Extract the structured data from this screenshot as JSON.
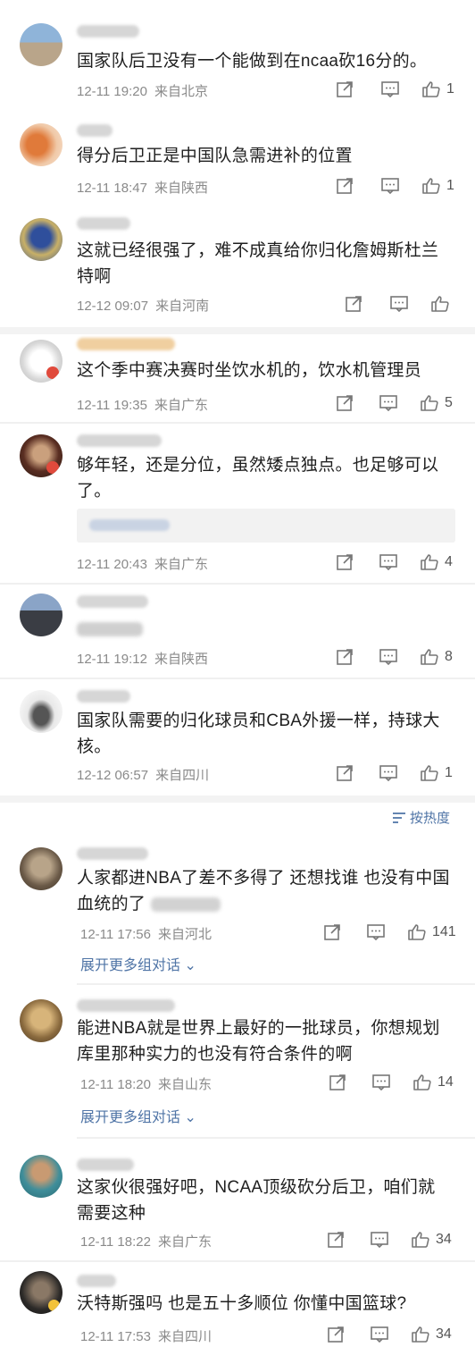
{
  "comments": [
    {
      "text": "国家队后卫没有一个能做到在ncaa砍16分的。",
      "time": "12-11 19:20",
      "location": "来自北京",
      "likes": "1"
    },
    {
      "text": "得分后卫正是中国队急需进补的位置",
      "time": "12-11 18:47",
      "location": "来自陕西",
      "likes": "1"
    },
    {
      "text": "这就已经很强了，难不成真给你归化詹姆斯杜兰特啊",
      "time": "12-12 09:07",
      "location": "来自河南",
      "likes": ""
    },
    {
      "text": "这个季中赛决赛时坐饮水机的，饮水机管理员",
      "time": "12-11 19:35",
      "location": "来自广东",
      "likes": "5"
    },
    {
      "text": "够年轻，还是分位，虽然矮点独点。也足够可以了。",
      "time": "12-11 20:43",
      "location": "来自广东",
      "likes": "4"
    },
    {
      "text": "",
      "time": "12-11 19:12",
      "location": "来自陕西",
      "likes": "8"
    },
    {
      "text": "国家队需要的归化球员和CBA外援一样，持球大核。",
      "time": "12-12 06:57",
      "location": "来自四川",
      "likes": "1"
    },
    {
      "text": "人家都进NBA了差不多得了 还想找谁 也没有中国血统的了",
      "time": "12-11 17:56",
      "location": "来自河北",
      "likes": "141"
    },
    {
      "text": "能进NBA就是世界上最好的一批球员，你想规划库里那种实力的也没有符合条件的啊",
      "time": "12-11 18:20",
      "location": "来自山东",
      "likes": "14"
    },
    {
      "text": "这家伙很强好吧，NCAA顶级砍分后卫，咱们就需要这种",
      "time": "12-11 18:22",
      "location": "来自广东",
      "likes": "34"
    },
    {
      "text": "沃特斯强吗 也是五十多顺位 你懂中国篮球?",
      "time": "12-11 17:53",
      "location": "来自四川",
      "likes": "34"
    }
  ],
  "sort_label": "按热度",
  "expand_label": "展开更多组对话",
  "icons": {
    "share": "share-icon",
    "comment": "comment-icon",
    "like": "thumbs-up-icon",
    "sort": "sort-lines-icon"
  }
}
